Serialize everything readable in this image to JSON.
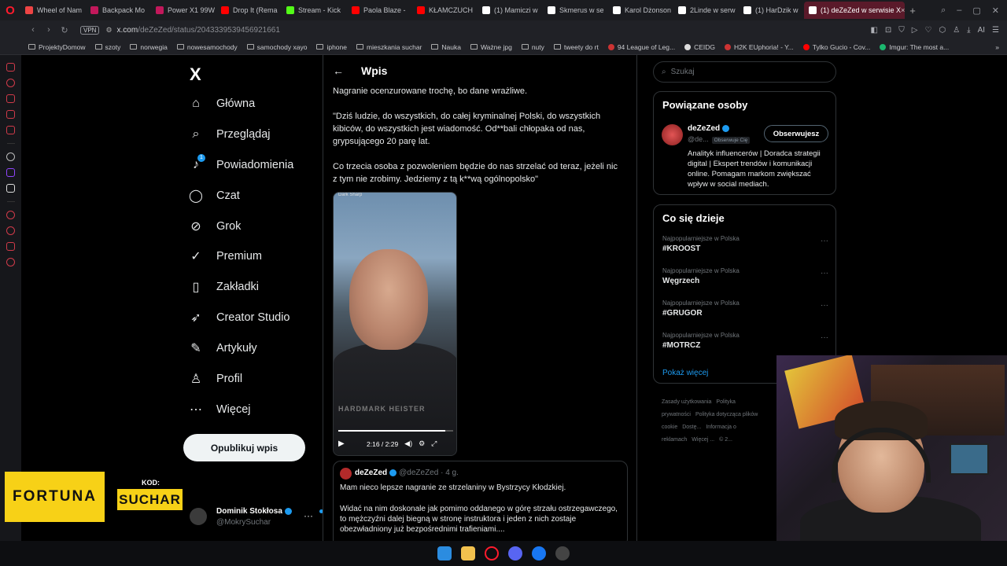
{
  "browser": {
    "tabs": [
      {
        "label": "Wheel of Nam",
        "color": "#e44"
      },
      {
        "label": "Backpack Mo",
        "color": "#c2185b"
      },
      {
        "label": "Power X1 99W",
        "color": "#c2185b"
      },
      {
        "label": "Drop It (Rema",
        "color": "#f00"
      },
      {
        "label": "Stream - Kick",
        "color": "#53fc18"
      },
      {
        "label": "Paola Blaze -",
        "color": "#f00"
      },
      {
        "label": "KŁAMCZUCH",
        "color": "#f00"
      },
      {
        "label": "(1) Mamiczi w",
        "color": "#fff"
      },
      {
        "label": "Skmerus w se",
        "color": "#fff"
      },
      {
        "label": "Karol Dżonson",
        "color": "#fff"
      },
      {
        "label": "2Linde w serw",
        "color": "#fff"
      },
      {
        "label": "(1) HarDzik w",
        "color": "#fff"
      }
    ],
    "active_tab": {
      "label": "(1) deZeZed w serwisie X",
      "close": "×"
    },
    "add_tab": "+",
    "vpn": "VPN",
    "url_host": "x.com",
    "url_path": "/deZeZed/status/2043339539456921661",
    "addr_ai": "AI",
    "bookmarks": [
      {
        "label": "ProjektyDomow",
        "kind": "folder"
      },
      {
        "label": "szoty",
        "kind": "folder"
      },
      {
        "label": "norwegia",
        "kind": "folder"
      },
      {
        "label": "nowesamochody",
        "kind": "folder"
      },
      {
        "label": "samochody xayo",
        "kind": "folder"
      },
      {
        "label": "iphone",
        "kind": "folder"
      },
      {
        "label": "mieszkania suchar",
        "kind": "folder"
      },
      {
        "label": "Nauka",
        "kind": "folder"
      },
      {
        "label": "Ważne jpg",
        "kind": "folder"
      },
      {
        "label": "nuty",
        "kind": "folder"
      },
      {
        "label": "tweety do rt",
        "kind": "folder"
      },
      {
        "label": "94 League of Leg...",
        "kind": "site",
        "color": "#c33"
      },
      {
        "label": "CEIDG",
        "kind": "site",
        "color": "#ddd"
      },
      {
        "label": "H2K EUphoria! - Y...",
        "kind": "site",
        "color": "#c33"
      },
      {
        "label": "Tylko Gucio - Cov...",
        "kind": "site",
        "color": "#f00"
      },
      {
        "label": "Imgur: The most a...",
        "kind": "site",
        "color": "#1bb76e"
      }
    ],
    "bookmarks_more": "»"
  },
  "nav": {
    "logo": "X",
    "items": [
      {
        "label": "Główna",
        "icon": "⌂",
        "name": "home"
      },
      {
        "label": "Przeglądaj",
        "icon": "⌕",
        "name": "explore"
      },
      {
        "label": "Powiadomienia",
        "icon": "♪",
        "name": "notifications",
        "badge": "1"
      },
      {
        "label": "Czat",
        "icon": "◯",
        "name": "chat"
      },
      {
        "label": "Grok",
        "icon": "⊘",
        "name": "grok"
      },
      {
        "label": "Premium",
        "icon": "✓",
        "name": "premium"
      },
      {
        "label": "Zakładki",
        "icon": "▯",
        "name": "bookmarks"
      },
      {
        "label": "Creator Studio",
        "icon": "➶",
        "name": "creator-studio"
      },
      {
        "label": "Artykuły",
        "icon": "✎",
        "name": "articles"
      },
      {
        "label": "Profil",
        "icon": "♙",
        "name": "profile"
      },
      {
        "label": "Więcej",
        "icon": "⋯",
        "name": "more"
      }
    ],
    "post_button": "Opublikuj wpis",
    "account": {
      "name": "Dominik Stokłosa",
      "handle": "@MokrySuchar",
      "more": "···"
    }
  },
  "post": {
    "header_title": "Wpis",
    "back": "←",
    "text_lines": [
      "Nagranie ocenzurowane trochę, bo dane wrażliwe.",
      "\"Dziś ludzie, do wszystkich, do całej kryminalnej Polski, do wszystkich kibiców, do wszystkich jest wiadomość. Od**bali chłopaka od nas, grypsującego 20 parę lat.",
      "Co trzecia osoba z pozwoleniem będzie do nas strzelać od teraz, jeżeli nic z tym nie zrobimy. Jedziemy z tą k**wą ogólnopolsko\""
    ],
    "video": {
      "top_label": "Dark Sharp",
      "shirt_text": "HARDMARK HEISTER",
      "time": "2:16 / 2:29",
      "progress": 0.93,
      "play": "▶"
    },
    "quote": {
      "name": "deZeZed",
      "handle": "@deZeZed",
      "age": "· 4 g.",
      "line1": "Mam nieco lepsze nagranie ze strzelaniny w Bystrzycy Kłodzkiej.",
      "line2": "Widać na nim doskonale jak pomimo oddanego w górę strzału ostrzegawczego, to mężczyźni dalej biegną w stronę instruktora i jeden z nich zostaje obezwładniony już bezpośrednimi trafieniami...."
    }
  },
  "right": {
    "search_placeholder": "Szukaj",
    "related": {
      "title": "Powiązane osoby",
      "name": "deZeZed",
      "handle": "@de...",
      "follows_you": "Obserwuje Cię",
      "follow_button": "Obserwujesz",
      "bio": "Analityk influencerów | Doradca strategii digital | Ekspert trendów i komunikacji online. Pomagam markom zwiększać wpływ w social mediach."
    },
    "trends": {
      "title": "Co się dzieje",
      "items": [
        {
          "context": "Najpopularniejsze w Polska",
          "name": "#KROOST"
        },
        {
          "context": "Najpopularniejsze w Polska",
          "name": "Węgrzech"
        },
        {
          "context": "Najpopularniejsze w Polska",
          "name": "#GRUGOR"
        },
        {
          "context": "Najpopularniejsze w Polska",
          "name": "#MOTRCZ"
        }
      ],
      "show_more": "Pokaż więcej"
    },
    "footer": [
      "Zasady użytkowania",
      "Polityka prywatności",
      "Polityka dotycząca plików cookie",
      "Dostę...",
      "Informacja o reklamach",
      "Więcej ...",
      "© 2..."
    ]
  },
  "overlay": {
    "sponsor": "FORTUNA",
    "kod_label": "KOD:",
    "kod_value": "SUCHAR"
  }
}
